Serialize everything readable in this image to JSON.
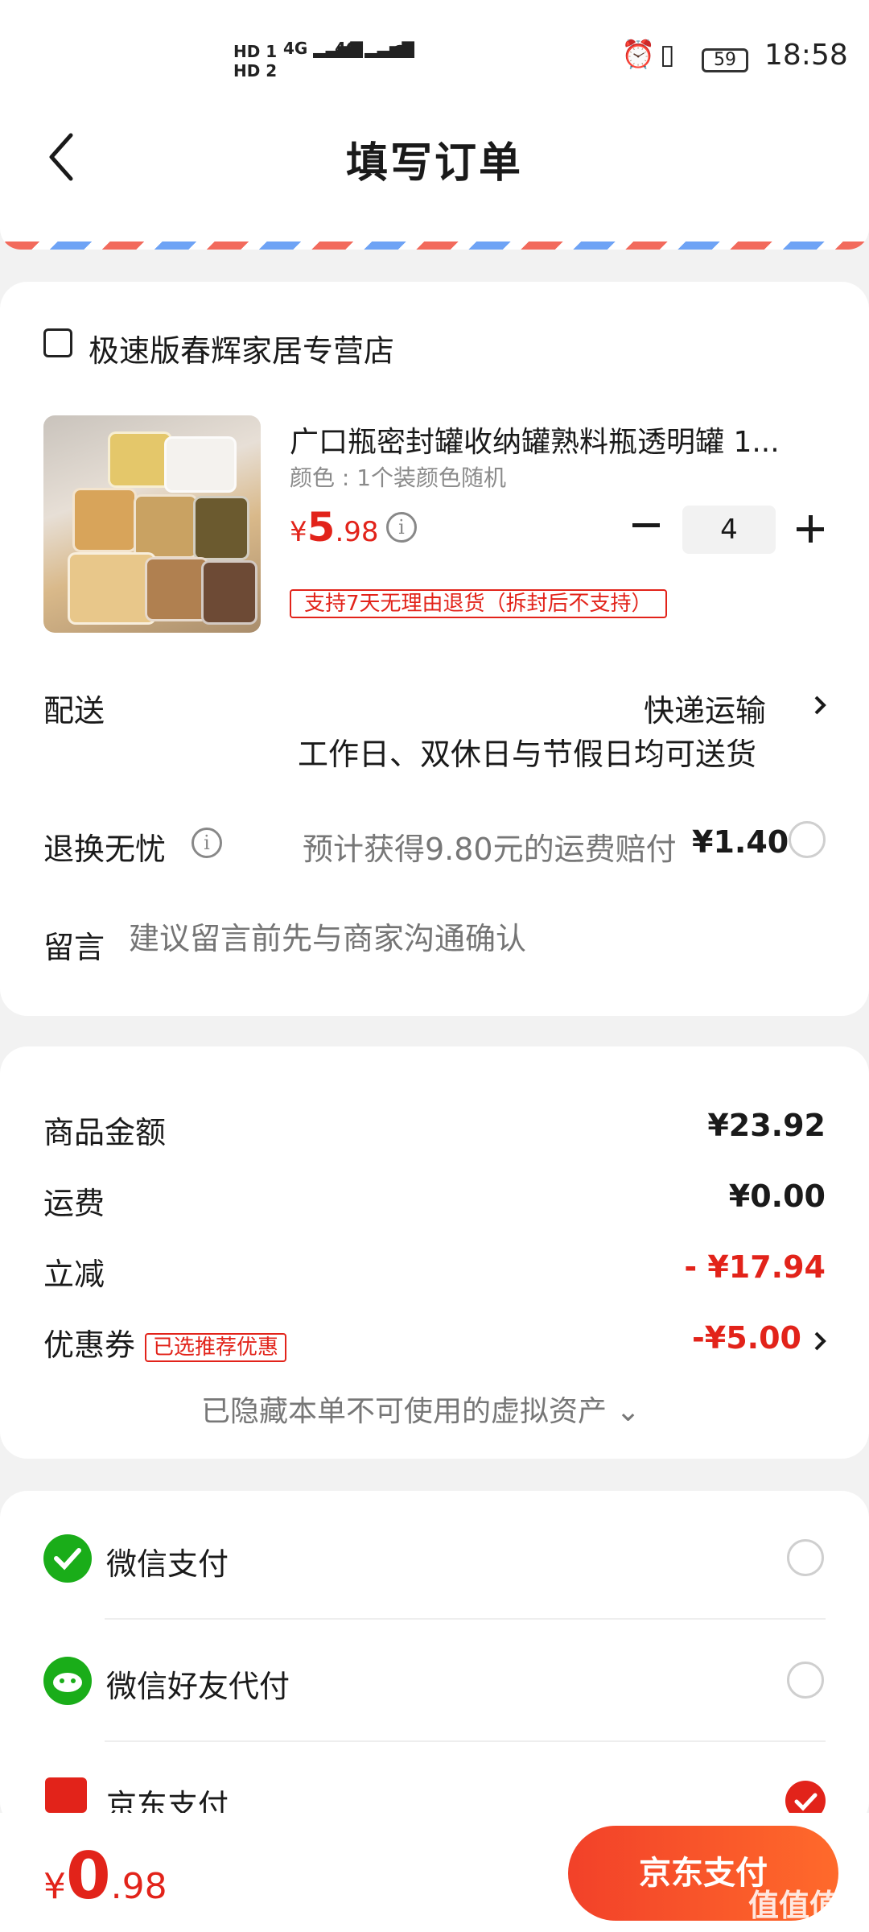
{
  "status_bar": {
    "hd1": "HD 1",
    "hd2": "HD 2",
    "net1": "4G",
    "net2": "4G",
    "battery": "59",
    "time": "18:58"
  },
  "header": {
    "title": "填写订单"
  },
  "store": {
    "name": "极速版春辉家居专营店"
  },
  "product": {
    "name": "广口瓶密封罐收纳罐熟料瓶透明罐 1...",
    "spec": "颜色 : 1个装颜色随机",
    "price_symbol": "¥",
    "price_int": "5",
    "price_dec": ".98",
    "info_icon": "i",
    "quantity": "4",
    "return_tag": "支持7天无理由退货（拆封后不支持）"
  },
  "delivery": {
    "label": "配送",
    "method": "快递运输",
    "note": "工作日、双休日与节假日均可送货"
  },
  "return_worry": {
    "label": "退换无忧",
    "info_icon": "i",
    "desc": "预计获得9.80元的运费赔付",
    "price": "¥1.40"
  },
  "message": {
    "label": "留言",
    "placeholder": "建议留言前先与商家沟通确认"
  },
  "summary": {
    "goods_label": "商品金额",
    "goods_value": "¥23.92",
    "freight_label": "运费",
    "freight_value": "¥0.00",
    "discount_label": "立减",
    "discount_value": "- ¥17.94",
    "coupon_label": "优惠券",
    "coupon_tag": "已选推荐优惠",
    "coupon_value": "-¥5.00",
    "hidden_assets": "已隐藏本单不可使用的虚拟资产"
  },
  "payment": [
    {
      "label": "微信支付",
      "icon": "wechat-pay-icon",
      "selected": false
    },
    {
      "label": "微信好友代付",
      "icon": "wechat-friend-pay-icon",
      "selected": false
    },
    {
      "label": "京东支付",
      "icon": "jd-pay-icon",
      "selected": true
    }
  ],
  "bottom": {
    "symbol": "¥",
    "int": "0",
    "dec": ".98",
    "button": "京东支付"
  },
  "watermark": "值值值",
  "colors": {
    "accent": "#e2231a",
    "wechat": "#1aad19"
  }
}
